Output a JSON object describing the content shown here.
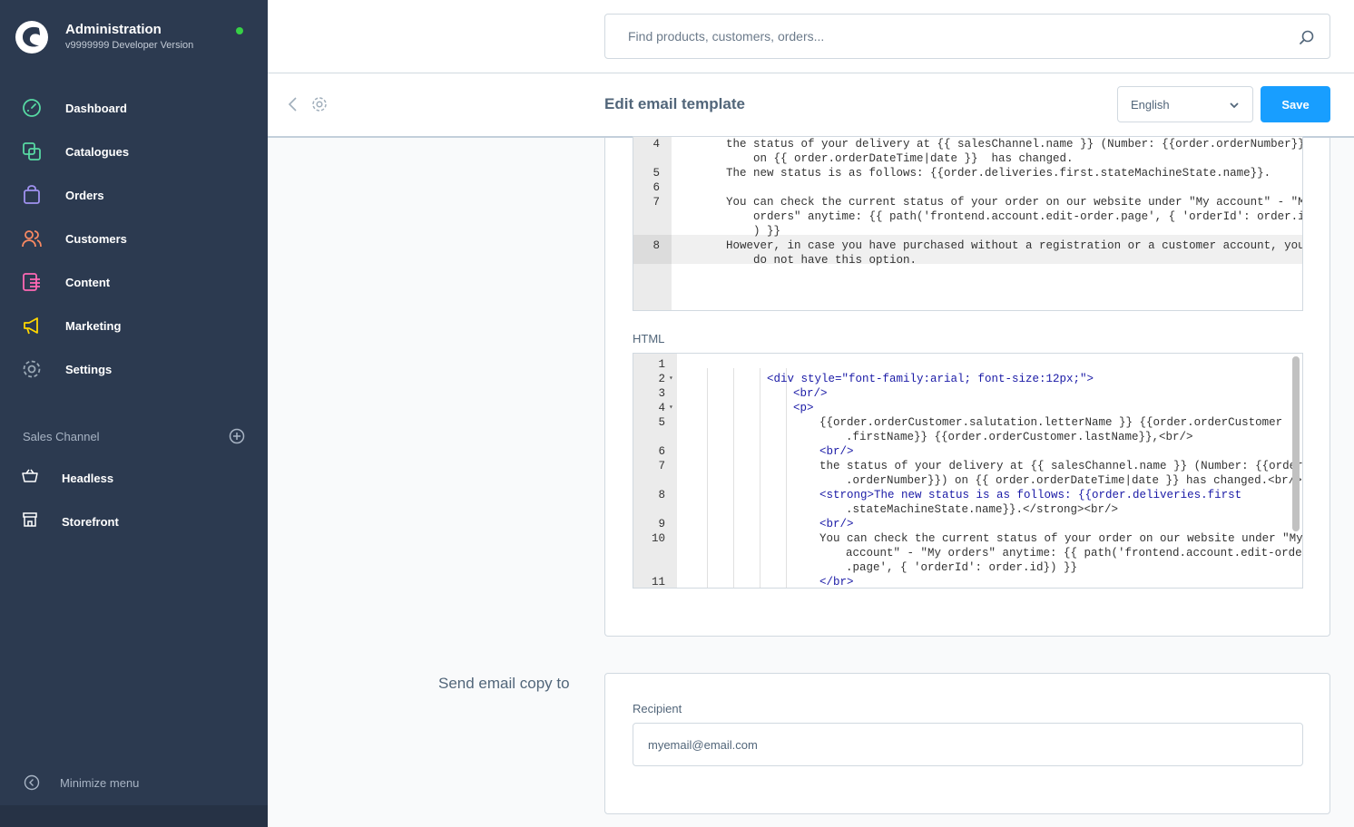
{
  "app": {
    "title": "Administration",
    "version": "v9999999 Developer Version"
  },
  "nav": {
    "items": [
      {
        "label": "Dashboard",
        "icon": "dashboard-icon",
        "color": "#57d9a3"
      },
      {
        "label": "Catalogues",
        "icon": "catalogue-icon",
        "color": "#57d9a3"
      },
      {
        "label": "Orders",
        "icon": "orders-icon",
        "color": "#a092f0"
      },
      {
        "label": "Customers",
        "icon": "customers-icon",
        "color": "#f88962"
      },
      {
        "label": "Content",
        "icon": "content-icon",
        "color": "#ff68b4"
      },
      {
        "label": "Marketing",
        "icon": "marketing-icon",
        "color": "#ffd700"
      },
      {
        "label": "Settings",
        "icon": "settings-icon",
        "color": "#9aa8b5"
      }
    ]
  },
  "sales_channel": {
    "title": "Sales Channel",
    "items": [
      {
        "label": "Headless",
        "icon": "basket-icon"
      },
      {
        "label": "Storefront",
        "icon": "storefront-icon"
      }
    ]
  },
  "minimize_label": "Minimize menu",
  "search": {
    "placeholder": "Find products, customers, orders..."
  },
  "smartbar": {
    "title": "Edit email template",
    "language": "English",
    "save_label": "Save"
  },
  "plain_editor": {
    "lines": [
      {
        "n": "4",
        "text": "the status of your delivery at {{ salesChannel.name }} (Number: {{order.orderNumber}})"
      },
      {
        "n": "",
        "text": "    on {{ order.orderDateTime|date }}  has changed."
      },
      {
        "n": "5",
        "text": "The new status is as follows: {{order.deliveries.first.stateMachineState.name}}."
      },
      {
        "n": "6",
        "text": ""
      },
      {
        "n": "7",
        "text": "You can check the current status of your order on our website under \"My account\" - \"My"
      },
      {
        "n": "",
        "text": "    orders\" anytime: {{ path('frontend.account.edit-order.page', { 'orderId': order.id}"
      },
      {
        "n": "",
        "text": "    ) }}"
      },
      {
        "n": "8",
        "text": "However, in case you have purchased without a registration or a customer account, you"
      },
      {
        "n": "",
        "text": "    do not have this option."
      }
    ]
  },
  "html_label": "HTML",
  "html_editor": {
    "lines": [
      {
        "n": "1",
        "fold": "",
        "indent": 0,
        "text": ""
      },
      {
        "n": "2",
        "fold": "▾",
        "indent": 3,
        "text": "<div style=\"font-family:arial; font-size:12px;\">"
      },
      {
        "n": "3",
        "fold": "",
        "indent": 4,
        "text": "<br/>"
      },
      {
        "n": "4",
        "fold": "▾",
        "indent": 4,
        "text": "<p>"
      },
      {
        "n": "5",
        "fold": "",
        "indent": 5,
        "text": "{{order.orderCustomer.salutation.letterName }} {{order.orderCustomer"
      },
      {
        "n": "",
        "fold": "",
        "indent": 6,
        "text": ".firstName}} {{order.orderCustomer.lastName}},<br/>"
      },
      {
        "n": "6",
        "fold": "",
        "indent": 5,
        "text": "<br/>"
      },
      {
        "n": "7",
        "fold": "",
        "indent": 5,
        "text": "the status of your delivery at {{ salesChannel.name }} (Number: {{order"
      },
      {
        "n": "",
        "fold": "",
        "indent": 6,
        "text": ".orderNumber}}) on {{ order.orderDateTime|date }} has changed.<br/>"
      },
      {
        "n": "8",
        "fold": "",
        "indent": 5,
        "text": "<strong>The new status is as follows: {{order.deliveries.first"
      },
      {
        "n": "",
        "fold": "",
        "indent": 6,
        "text": ".stateMachineState.name}}.</strong><br/>"
      },
      {
        "n": "9",
        "fold": "",
        "indent": 5,
        "text": "<br/>"
      },
      {
        "n": "10",
        "fold": "",
        "indent": 5,
        "text": "You can check the current status of your order on our website under \"My"
      },
      {
        "n": "",
        "fold": "",
        "indent": 6,
        "text": "account\" - \"My orders\" anytime: {{ path('frontend.account.edit-order"
      },
      {
        "n": "",
        "fold": "",
        "indent": 6,
        "text": ".page', { 'orderId': order.id}) }}"
      },
      {
        "n": "11",
        "fold": "",
        "indent": 5,
        "text": "</br>"
      }
    ]
  },
  "send_copy": {
    "section_label": "Send email copy to",
    "recipient_label": "Recipient",
    "recipient_value": "myemail@email.com"
  },
  "colors": {
    "sidebar": "#2c3a50",
    "accent": "#189eff",
    "status_online": "#37d046"
  }
}
